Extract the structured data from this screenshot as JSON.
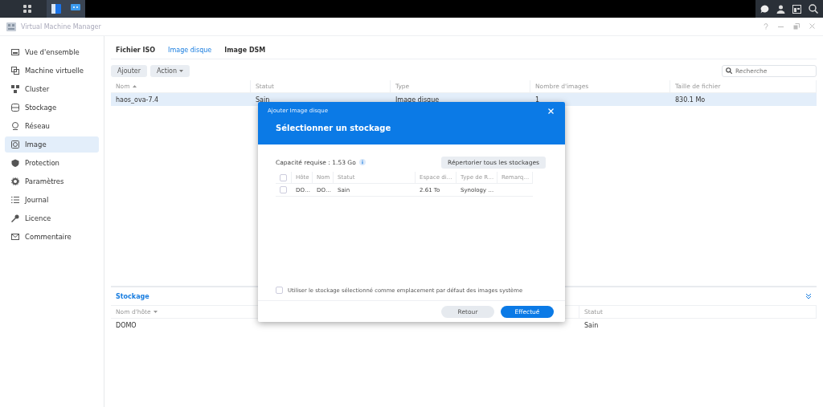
{
  "window": {
    "title": "Virtual Machine Manager"
  },
  "sidebar": {
    "items": [
      {
        "label": "Vue d'ensemble",
        "selected": false
      },
      {
        "label": "Machine virtuelle",
        "selected": false
      },
      {
        "label": "Cluster",
        "selected": false
      },
      {
        "label": "Stockage",
        "selected": false
      },
      {
        "label": "Réseau",
        "selected": false
      },
      {
        "label": "Image",
        "selected": true
      },
      {
        "label": "Protection",
        "selected": false
      },
      {
        "label": "Paramètres",
        "selected": false
      },
      {
        "label": "Journal",
        "selected": false
      },
      {
        "label": "Licence",
        "selected": false
      },
      {
        "label": "Commentaire",
        "selected": false
      }
    ]
  },
  "tabs": [
    {
      "label": "Fichier ISO",
      "selected": false
    },
    {
      "label": "Image disque",
      "selected": true
    },
    {
      "label": "Image DSM",
      "selected": false
    }
  ],
  "toolbar": {
    "buttons": [
      {
        "label": "Ajouter",
        "kind": "button"
      },
      {
        "label": "Action",
        "kind": "dropdown"
      }
    ],
    "search": {
      "placeholder": "Recherche"
    }
  },
  "table": {
    "columns": [
      "Nom",
      "Statut",
      "Type",
      "Nombre d'images",
      "Taille de fichier"
    ],
    "rows": [
      {
        "cells": [
          "haos_ova-7.4",
          "Sain",
          "Image disque",
          "1",
          "830.1 Mo"
        ],
        "selected": true
      }
    ]
  },
  "storage_panel": {
    "title": "Stockage",
    "columns": [
      "Nom d'hôte",
      "Statut"
    ],
    "rows": [
      {
        "cells": [
          "DOMO",
          "Sain"
        ]
      }
    ]
  },
  "dialog": {
    "caption": "Ajouter Image disque",
    "title": "Sélectionner un stockage",
    "capacity": "Capacité requise : 1.53 Go",
    "list_all_button": "Répertorier tous les stockages",
    "table": {
      "all_checked": false,
      "columns": [
        "Hôte",
        "Nom",
        "Statut",
        "Espace di…",
        "Type de R…",
        "Remarq…"
      ],
      "rows": [
        {
          "cells": [
            "DO…",
            "DO…",
            "Sain",
            "2.61 To",
            "Synology …"
          ],
          "checked": false
        }
      ]
    },
    "default_checkbox": {
      "label": "Utiliser le stockage sélectionné comme emplacement par défaut des images système",
      "checked": false
    },
    "buttons": [
      {
        "label": "Retour",
        "kind": "secondary"
      },
      {
        "label": "Effectué",
        "kind": "primary"
      }
    ]
  }
}
